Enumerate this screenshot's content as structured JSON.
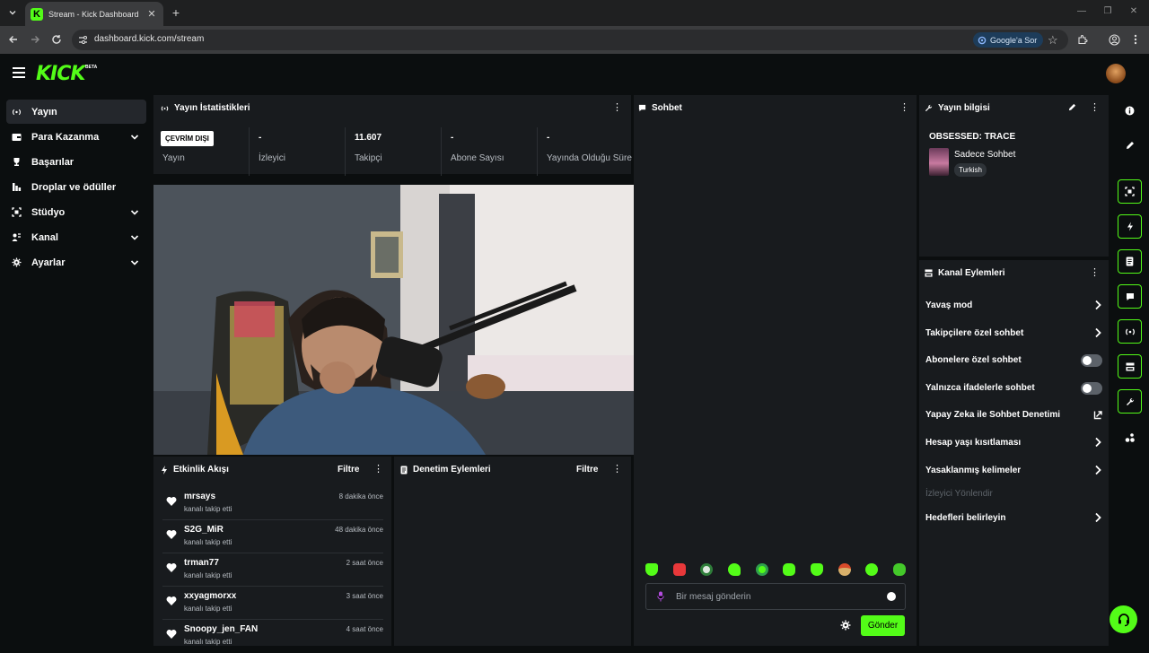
{
  "browser": {
    "tab_title": "Stream - Kick Dashboard",
    "tab_favicon": "K",
    "url": "dashboard.kick.com/stream",
    "google_chip": "Google'a Sor"
  },
  "brand": {
    "logo": "KICK",
    "beta": "BETA",
    "accent": "#53fc18"
  },
  "sidebar": {
    "items": [
      {
        "label": "Yayın",
        "icon": "broadcast-icon",
        "active": true
      },
      {
        "label": "Para Kazanma",
        "icon": "wallet-icon",
        "expandable": true
      },
      {
        "label": "Başarılar",
        "icon": "trophy-icon"
      },
      {
        "label": "Droplar ve ödüller",
        "icon": "drops-icon"
      },
      {
        "label": "Stüdyo",
        "icon": "studio-icon",
        "expandable": true
      },
      {
        "label": "Kanal",
        "icon": "channel-icon",
        "expandable": true
      },
      {
        "label": "Ayarlar",
        "icon": "gear-icon",
        "expandable": true
      }
    ]
  },
  "stats": {
    "title": "Yayın İstatistikleri",
    "offline_badge": "ÇEVRİM DIŞI",
    "columns": [
      {
        "value": "",
        "label": "Yayın"
      },
      {
        "value": "-",
        "label": "İzleyici"
      },
      {
        "value": "11.607",
        "label": "Takipçi"
      },
      {
        "value": "-",
        "label": "Abone Sayısı"
      },
      {
        "value": "-",
        "label": "Yayında Olduğu Süre"
      }
    ]
  },
  "activity": {
    "title": "Etkinlik Akışı",
    "filter": "Filtre",
    "items": [
      {
        "user": "mrsays",
        "desc": "kanalı takip etti",
        "time": "8 dakika önce"
      },
      {
        "user": "S2G_MiR",
        "desc": "kanalı takip etti",
        "time": "48 dakika önce"
      },
      {
        "user": "trman77",
        "desc": "kanalı takip etti",
        "time": "2 saat önce"
      },
      {
        "user": "xxyagmorxx",
        "desc": "kanalı takip etti",
        "time": "3 saat önce"
      },
      {
        "user": "Snoopy_jen_FAN",
        "desc": "kanalı takip etti",
        "time": "4 saat önce"
      }
    ]
  },
  "moderation": {
    "title": "Denetim Eylemleri",
    "filter": "Filtre"
  },
  "chat": {
    "title": "Sohbet",
    "placeholder": "Bir mesaj gönderin",
    "send": "Gönder"
  },
  "stream_info": {
    "title": "Yayın bilgisi",
    "stream_title": "OBSESSED: TRACE",
    "category": "Sadece Sohbet",
    "tag": "Turkish"
  },
  "channel_actions": {
    "title": "Kanal Eylemleri",
    "items": [
      {
        "label": "Yavaş mod",
        "control": "chevron"
      },
      {
        "label": "Takipçilere özel sohbet",
        "control": "chevron"
      },
      {
        "label": "Abonelere özel sohbet",
        "control": "toggle",
        "on": false
      },
      {
        "label": "Yalnızca ifadelerle sohbet",
        "control": "toggle",
        "on": false
      },
      {
        "label": "Yapay Zeka ile Sohbet Denetimi",
        "control": "external"
      },
      {
        "label": "Hesap yaşı kısıtlaması",
        "control": "chevron"
      },
      {
        "label": "Yasaklanmış kelimeler",
        "control": "chevron"
      }
    ],
    "section_label": "İzleyici Yönlendir",
    "goals_label": "Hedefleri belirleyin"
  }
}
